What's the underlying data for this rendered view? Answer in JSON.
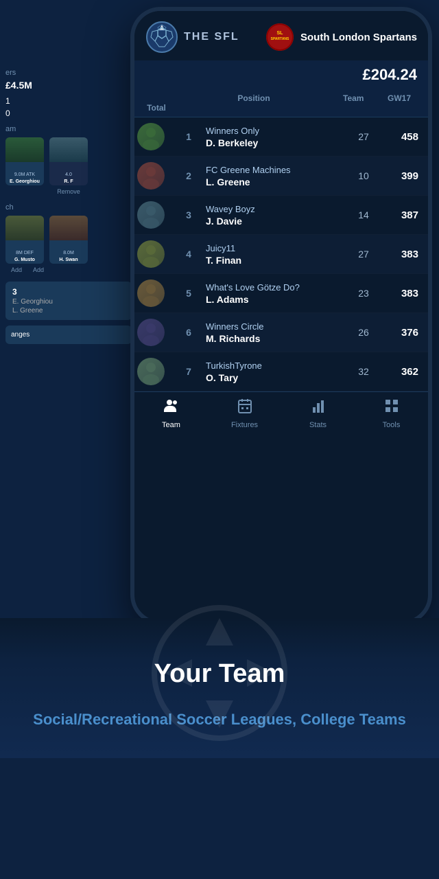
{
  "app": {
    "name": "THE SFL",
    "balance": "£204.24"
  },
  "header": {
    "team_name": "South London Spartans"
  },
  "table": {
    "columns": [
      "",
      "Position",
      "Team",
      "GW17",
      "Total"
    ],
    "rows": [
      {
        "rank": 1,
        "team": "Winners Only",
        "manager": "D. Berkeley",
        "gw": 27,
        "total": 458,
        "avatar_color": "#3a6a3a"
      },
      {
        "rank": 2,
        "team": "FC Greene Machines",
        "manager": "L. Greene",
        "gw": 10,
        "total": 399,
        "avatar_color": "#6a3a3a"
      },
      {
        "rank": 3,
        "team": "Wavey Boyz",
        "manager": "J. Davie",
        "gw": 14,
        "total": 387,
        "avatar_color": "#3a5a6a"
      },
      {
        "rank": 4,
        "team": "Juicy11",
        "manager": "T. Finan",
        "gw": 27,
        "total": 383,
        "avatar_color": "#5a6a3a"
      },
      {
        "rank": 5,
        "team": "What's Love Götze Do?",
        "manager": "L. Adams",
        "gw": 23,
        "total": 383,
        "avatar_color": "#6a5a3a"
      },
      {
        "rank": 6,
        "team": "Winners Circle",
        "manager": "M. Richards",
        "gw": 26,
        "total": 376,
        "avatar_color": "#3a3a6a"
      },
      {
        "rank": 7,
        "team": "TurkishTyrone",
        "manager": "O. Tary",
        "gw": 32,
        "total": 362,
        "avatar_color": "#4a6a5a"
      }
    ]
  },
  "nav": {
    "items": [
      {
        "label": "Team",
        "icon": "👥",
        "active": true
      },
      {
        "label": "Fixtures",
        "icon": "📅",
        "active": false
      },
      {
        "label": "Stats",
        "icon": "📊",
        "active": false
      },
      {
        "label": "Tools",
        "icon": "🔧",
        "active": false
      }
    ]
  },
  "left_panel": {
    "balance_label": "£4.5M",
    "val1": "1",
    "val2": "0",
    "team_label": "am",
    "player1_name": "E. Georghiou",
    "player1_val": "9.0M",
    "player1_pos": "ATK",
    "player2_name": "R. F",
    "player2_val": "4.0",
    "remove": "Remove",
    "search_label": "ch",
    "search_player1": "G. Musto",
    "search_p1_val": "8M",
    "search_p1_pos": "DEF",
    "search_p1_add": "Add",
    "search_player2": "H. Swan",
    "search_p2_val": "8.0M",
    "search_p2_add": "Add",
    "changes_count": "3",
    "name1": "E. Georghiou",
    "name2": "L. Greene",
    "changes_btn": "anges"
  },
  "marketing": {
    "title": "Your Team",
    "subtitle": "Social/Recreational Soccer Leagues, College Teams"
  }
}
